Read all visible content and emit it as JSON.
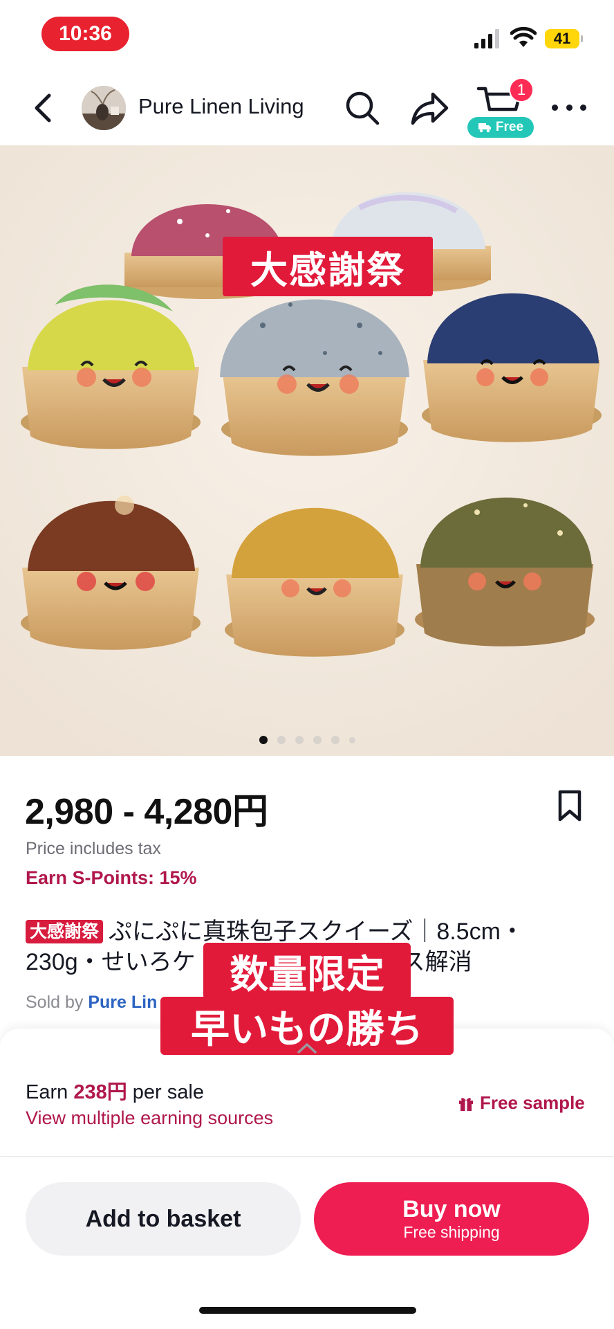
{
  "status_bar": {
    "time": "10:36",
    "battery": "41"
  },
  "nav": {
    "shop_name": "Pure Linen Living",
    "cart_count": "1",
    "free_label": "Free"
  },
  "image": {
    "promo_tag": "大感謝祭",
    "carousel_count": 6,
    "carousel_active": 0
  },
  "product": {
    "price": "2,980 - 4,280円",
    "tax_note": "Price includes tax",
    "spoints": "Earn S-Points: 15%",
    "title_tag": "大感謝祭",
    "title": "ぷにぷに真珠包子スクイーズ｜8.5cm・230g・せいろケ",
    "title_tail": "ストレス解消",
    "sold_by_label": "Sold by",
    "seller": "Pure Lin"
  },
  "overlay": {
    "line1": "数量限定",
    "line2": "早いもの勝ち"
  },
  "earnings": {
    "earn_prefix": "Earn",
    "amount": "238円",
    "earn_suffix": "per sale",
    "sources_link": "View multiple earning sources",
    "free_sample": "Free sample"
  },
  "actions": {
    "add_to_basket": "Add to basket",
    "buy_now": "Buy now",
    "buy_now_sub": "Free shipping"
  },
  "colors": {
    "accent": "#ee1d52",
    "points": "#b0174c",
    "promo": "#e11a3a",
    "free_pill": "#22c7b8"
  }
}
